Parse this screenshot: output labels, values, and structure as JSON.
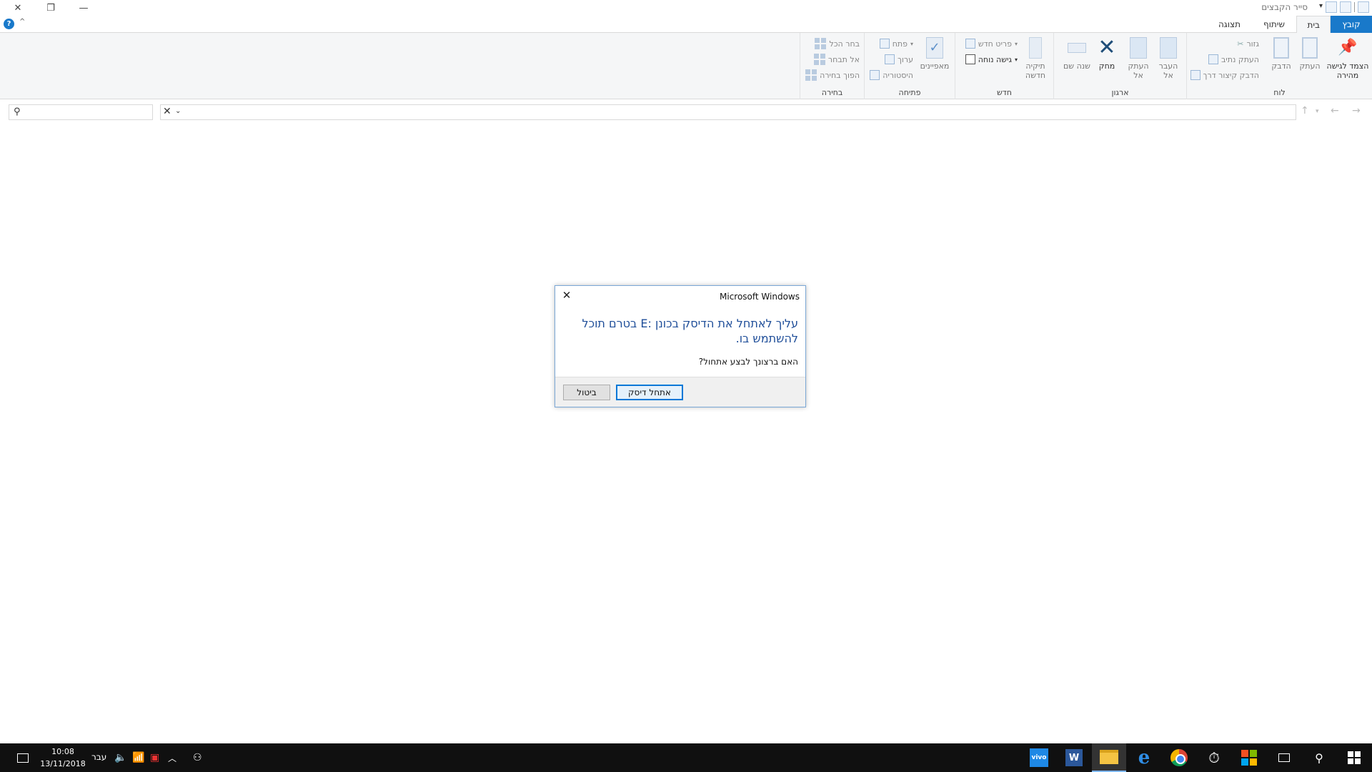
{
  "window": {
    "title": "סייר הקבצים",
    "close_glyph": "✕",
    "restore_glyph": "❐",
    "minimize_glyph": "—"
  },
  "tabs": {
    "file": "קובץ",
    "home": "בית",
    "share": "שיתוף",
    "view": "תצוגה"
  },
  "ribbon": {
    "clipboard": {
      "label": "לוח",
      "pin": "הצמד לגישה מהירה",
      "copy": "העתק",
      "paste": "הדבק",
      "cut": "גזור",
      "copy_path": "העתק נתיב",
      "paste_shortcut": "הדבק קיצור דרך"
    },
    "organize": {
      "label": "ארגון",
      "move_to": "העבר אל",
      "copy_to": "העתק אל",
      "delete": "מחק",
      "rename": "שנה שם"
    },
    "new": {
      "label": "חדש",
      "new_folder": "תיקיה חדשה",
      "new_item": "פריט חדש",
      "easy_access": "גישה נוחה"
    },
    "open": {
      "label": "פתיחה",
      "properties": "מאפיינים",
      "open": "פתח",
      "edit": "ערוך",
      "history": "היסטוריה"
    },
    "select": {
      "label": "בחירה",
      "select_all": "בחר הכל",
      "select_none": "אל תבחר",
      "invert": "הפוך בחירה"
    }
  },
  "dialog": {
    "title": "Microsoft Windows",
    "message": "עליך לאתחל את הדיסק בכונן :E בטרם תוכל להשתמש בו.",
    "question": "האם ברצונך לבצע אתחול?",
    "format_button": "אתחל דיסק",
    "cancel_button": "ביטול"
  },
  "taskbar": {
    "time": "10:08",
    "date": "13/11/2018",
    "language": "עבר",
    "vivo_label": "vivo",
    "word_label": "W"
  },
  "colors": {
    "accent": "#1979ca",
    "dialog_heading": "#1f4e99",
    "taskbar": "#101010"
  }
}
